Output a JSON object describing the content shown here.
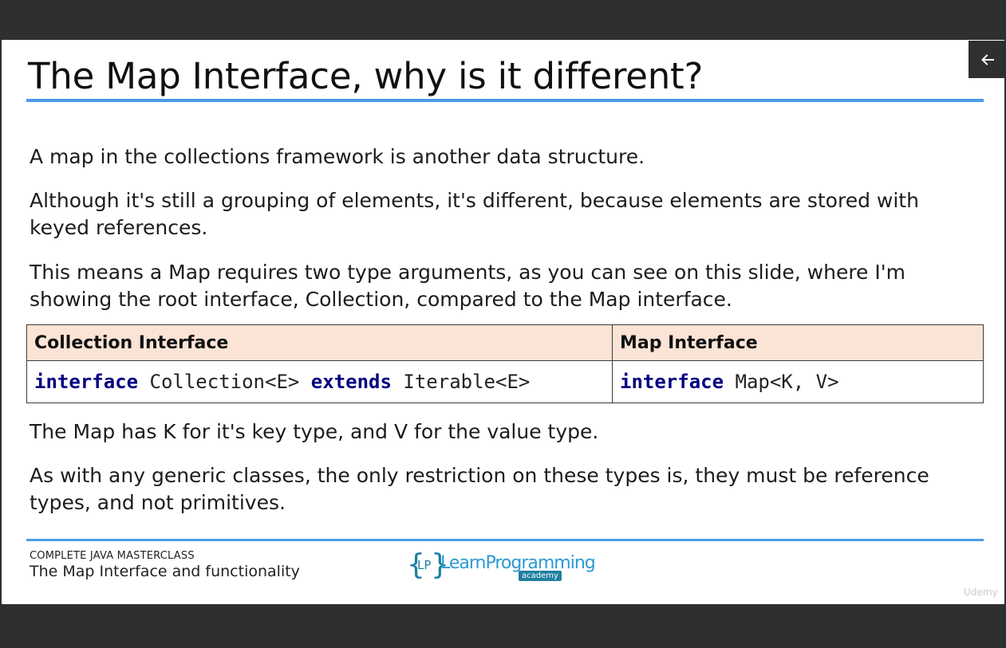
{
  "slide": {
    "title": "The Map Interface, why is it different?",
    "paragraphs": [
      "A map in the collections framework is another data structure.",
      "Although it's still a grouping of elements, it's different, because elements are stored with keyed references.",
      "This means a Map requires two type arguments, as you can see on this slide, where I'm showing the root interface, Collection, compared to the Map interface.",
      "The Map has K for it's key type, and V for the value type.",
      "As with any generic classes, the only restriction on these types is, they must be reference types, and not primitives."
    ],
    "table": {
      "headers": [
        "Collection Interface",
        "Map Interface"
      ],
      "collection_code": {
        "kw1": "interface",
        "name": " Collection<E> ",
        "kw2": "extends",
        "rest": " Iterable<E>"
      },
      "map_code": {
        "kw1": "interface",
        "name": " Map<K, V>"
      }
    },
    "footer": {
      "course": "COMPLETE JAVA MASTERCLASS",
      "lecture": "The Map Interface and functionality",
      "logo_lp": "LP",
      "logo_text": "LearnProgramming",
      "logo_academy": "academy"
    }
  },
  "player": {
    "back_icon": "arrow-left-icon",
    "watermark": "Udemy"
  },
  "colors": {
    "accent_rule": "#4b9be8",
    "table_header_bg": "#fbe4d6",
    "keyword": "#000080",
    "frame": "#2d2f31"
  }
}
